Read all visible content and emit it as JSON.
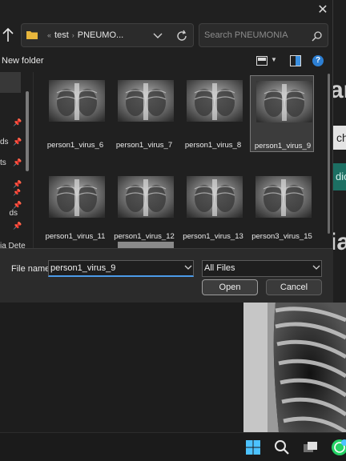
{
  "background": {
    "big_text_1": "ar",
    "big_text_2": "ia",
    "cell_text": "ch",
    "teal_text": "dic"
  },
  "dialog": {
    "close_symbol": "✕",
    "address": {
      "ellipsis": "«",
      "crumb1": "test",
      "crumb2": "PNEUMO..."
    },
    "search_placeholder": "Search PNEUMONIA",
    "new_folder_label": "New folder",
    "help_symbol": "?",
    "nav_items": [
      {
        "label": "ds",
        "pin": "📌"
      },
      {
        "label": "ts",
        "pin": "📌"
      },
      {
        "label": "",
        "pin": "📌"
      },
      {
        "label": "",
        "pin": "📌"
      },
      {
        "label": "",
        "pin": "📌"
      }
    ],
    "nav_bottom_label": "ia Dete",
    "files": [
      {
        "name": "person1_virus_6",
        "selected": false
      },
      {
        "name": "person1_virus_7",
        "selected": false
      },
      {
        "name": "person1_virus_8",
        "selected": false
      },
      {
        "name": "person1_virus_9",
        "selected": true
      },
      {
        "name": "person1_virus_11",
        "selected": false
      },
      {
        "name": "person1_virus_12",
        "selected": false
      },
      {
        "name": "person1_virus_13",
        "selected": false
      },
      {
        "name": "person3_virus_15",
        "selected": false
      }
    ],
    "file_name_label": "File name:",
    "file_name_value": "person1_virus_9",
    "file_type_value": "All Files",
    "open_label": "Open",
    "cancel_label": "Cancel"
  },
  "colors": {
    "accent": "#2d7fd3",
    "dialog_bg": "#202020",
    "teal": "#1c6f63"
  }
}
